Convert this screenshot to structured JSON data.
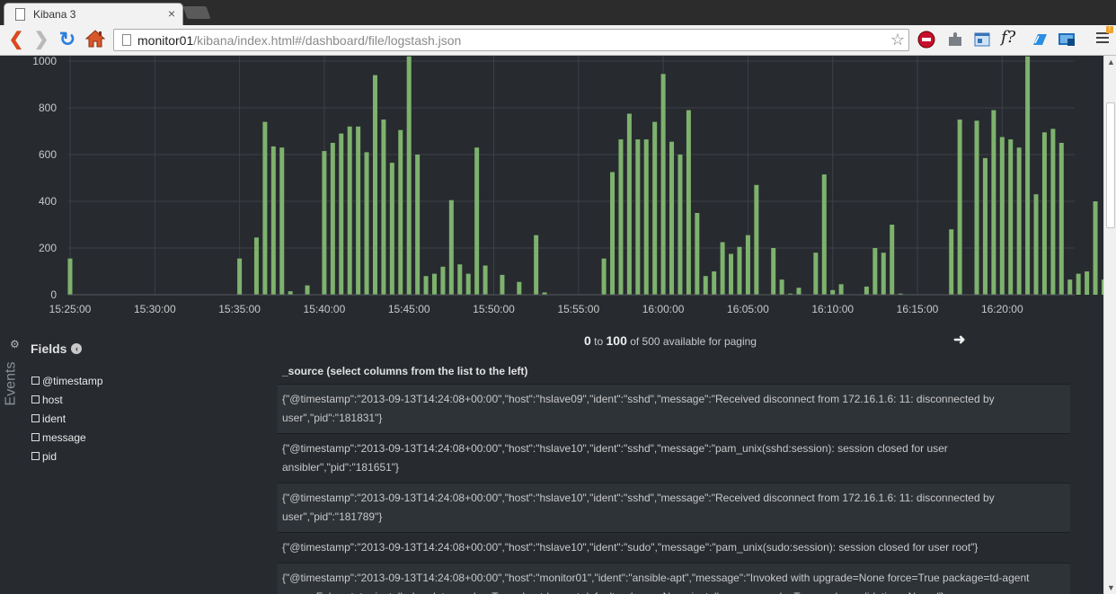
{
  "browser": {
    "tab_title": "Kibana 3",
    "tab_close": "×",
    "url_host": "monitor01",
    "url_path": "/kibana/index.html#/dashboard/file/logstash.json",
    "menu_badge": "!"
  },
  "chart_data": {
    "type": "bar",
    "ylim": [
      0,
      1000
    ],
    "yticks": [
      0,
      200,
      400,
      600,
      800,
      1000
    ],
    "xticks": [
      "15:25:00",
      "15:30:00",
      "15:35:00",
      "15:40:00",
      "15:45:00",
      "15:50:00",
      "15:55:00",
      "16:00:00",
      "16:05:00",
      "16:10:00",
      "16:15:00",
      "16:20:00"
    ],
    "x_start": "15:25:00",
    "bucket_seconds": 30,
    "grid": true,
    "color": "#7eb26d",
    "values": [
      155,
      0,
      0,
      0,
      0,
      0,
      0,
      0,
      0,
      0,
      0,
      0,
      0,
      0,
      0,
      0,
      0,
      0,
      0,
      0,
      155,
      0,
      245,
      740,
      635,
      630,
      15,
      0,
      40,
      0,
      615,
      650,
      690,
      720,
      720,
      610,
      940,
      750,
      565,
      705,
      1020,
      600,
      80,
      90,
      120,
      405,
      130,
      90,
      630,
      125,
      0,
      85,
      0,
      55,
      0,
      255,
      10,
      0,
      0,
      0,
      0,
      0,
      0,
      155,
      525,
      665,
      775,
      665,
      665,
      740,
      945,
      655,
      600,
      790,
      350,
      80,
      100,
      225,
      175,
      205,
      255,
      470,
      0,
      200,
      65,
      5,
      30,
      0,
      180,
      515,
      20,
      45,
      0,
      0,
      35,
      200,
      180,
      300,
      5,
      0,
      0,
      0,
      0,
      0,
      280,
      750,
      0,
      745,
      585,
      790,
      675,
      665,
      630,
      1020,
      430,
      695,
      710,
      650,
      65,
      90,
      100,
      400,
      65
    ]
  },
  "events": {
    "tab_label": "Events",
    "gear": "⚙"
  },
  "fields": {
    "title": "Fields",
    "collapse": "‹",
    "items": [
      "@timestamp",
      "host",
      "ident",
      "message",
      "pid"
    ]
  },
  "paging": {
    "from": "0",
    "to_word": "to",
    "to": "100",
    "suffix": "of 500 available for paging",
    "next": "➜"
  },
  "table": {
    "header": "_source (select columns from the list to the left)",
    "rows": [
      "{\"@timestamp\":\"2013-09-13T14:24:08+00:00\",\"host\":\"hslave09\",\"ident\":\"sshd\",\"message\":\"Received disconnect from 172.16.1.6: 11: disconnected by user\",\"pid\":\"181831\"}",
      "{\"@timestamp\":\"2013-09-13T14:24:08+00:00\",\"host\":\"hslave10\",\"ident\":\"sshd\",\"message\":\"pam_unix(sshd:session): session closed for user ansibler\",\"pid\":\"181651\"}",
      "{\"@timestamp\":\"2013-09-13T14:24:08+00:00\",\"host\":\"hslave10\",\"ident\":\"sshd\",\"message\":\"Received disconnect from 172.16.1.6: 11: disconnected by user\",\"pid\":\"181789\"}",
      "{\"@timestamp\":\"2013-09-13T14:24:08+00:00\",\"host\":\"hslave10\",\"ident\":\"sudo\",\"message\":\"pam_unix(sudo:session): session closed for user root\"}",
      "{\"@timestamp\":\"2013-09-13T14:24:08+00:00\",\"host\":\"monitor01\",\"ident\":\"ansible-apt\",\"message\":\"Invoked with upgrade=None force=True package=td-agent purge=False state=installed update_cache=True pkg=td-agent default_release=None install_recommends=True cache_valid_time=None \"}"
    ]
  }
}
